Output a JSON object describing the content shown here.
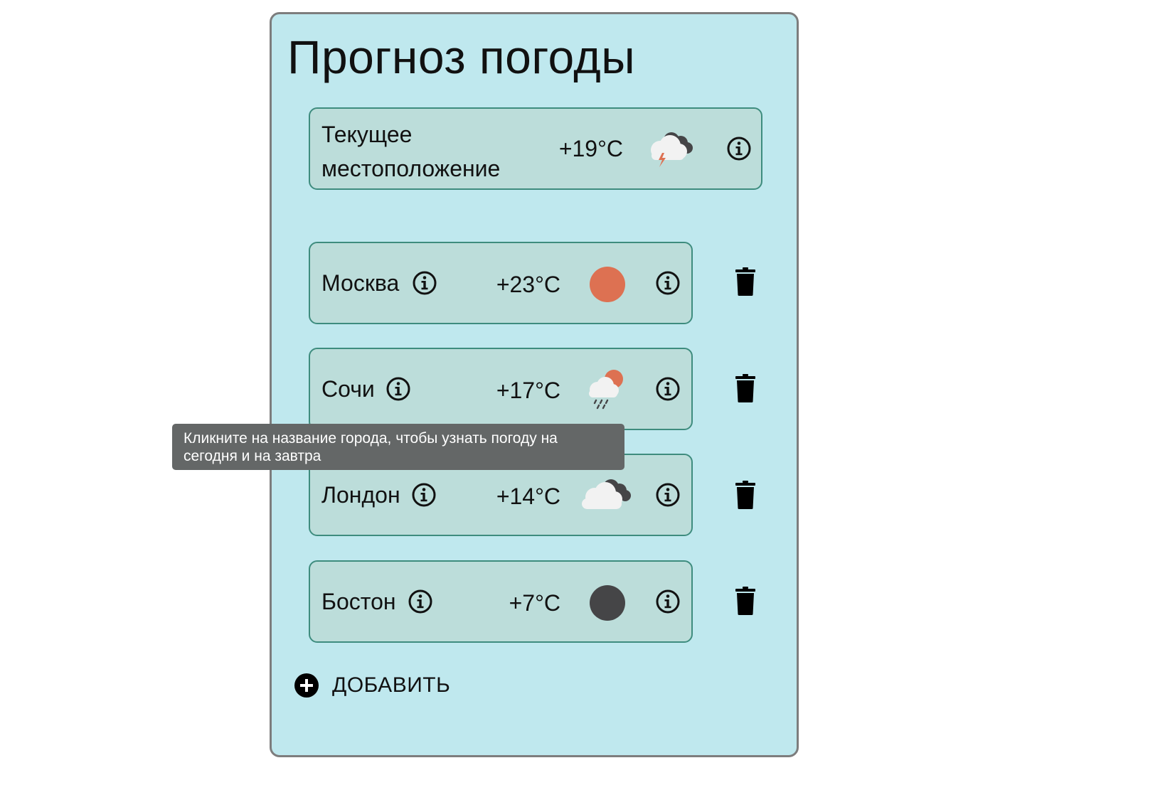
{
  "app": {
    "title": "Прогноз погоды"
  },
  "current": {
    "name": "Текущее местоположение",
    "temp": "+19°C",
    "icon": "thunderstorm-icon"
  },
  "cities": [
    {
      "name": "Москва",
      "temp": "+23°C",
      "icon": "sun-icon"
    },
    {
      "name": "Сочи",
      "temp": "+17°C",
      "icon": "rain-sun-icon"
    },
    {
      "name": "Лондон",
      "temp": "+14°C",
      "icon": "cloudy-icon"
    },
    {
      "name": "Бостон",
      "temp": "+7°C",
      "icon": "dark-circle-icon"
    }
  ],
  "tooltip": {
    "text": "Кликните на название города, чтобы узнать погоду на сегодня и на завтра"
  },
  "add": {
    "label": "ДОБАВИТЬ"
  },
  "colors": {
    "panel_bg": "#bfe8ee",
    "card_bg": "#bcddda",
    "card_border": "#3e8c7e",
    "sun": "#dd7152",
    "dark": "#454547",
    "tooltip_bg": "#646767"
  }
}
